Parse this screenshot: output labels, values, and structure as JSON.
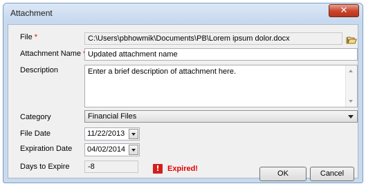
{
  "window": {
    "title": "Attachment",
    "close_glyph": "✕"
  },
  "form": {
    "file": {
      "label": "File",
      "required": "*",
      "value": "C:\\Users\\pbhowmik\\Documents\\PB\\Lorem ipsum dolor.docx",
      "browse_icon": "folder-open-icon"
    },
    "attachment_name": {
      "label": "Attachment Name",
      "required": "*",
      "value": "Updated attachment name"
    },
    "description": {
      "label": "Description",
      "value": "Enter a brief description of attachment here."
    },
    "category": {
      "label": "Category",
      "value": "Financial Files"
    },
    "file_date": {
      "label": "File Date",
      "value": "11/22/2013"
    },
    "expiration_date": {
      "label": "Expiration Date",
      "value": "04/02/2014"
    },
    "days_to_expire": {
      "label": "Days to Expire",
      "value": "-8"
    },
    "status": {
      "icon": "warning-icon",
      "glyph": "!",
      "text": "Expired!",
      "color": "#e00000"
    }
  },
  "buttons": {
    "ok": "OK",
    "cancel": "Cancel"
  }
}
